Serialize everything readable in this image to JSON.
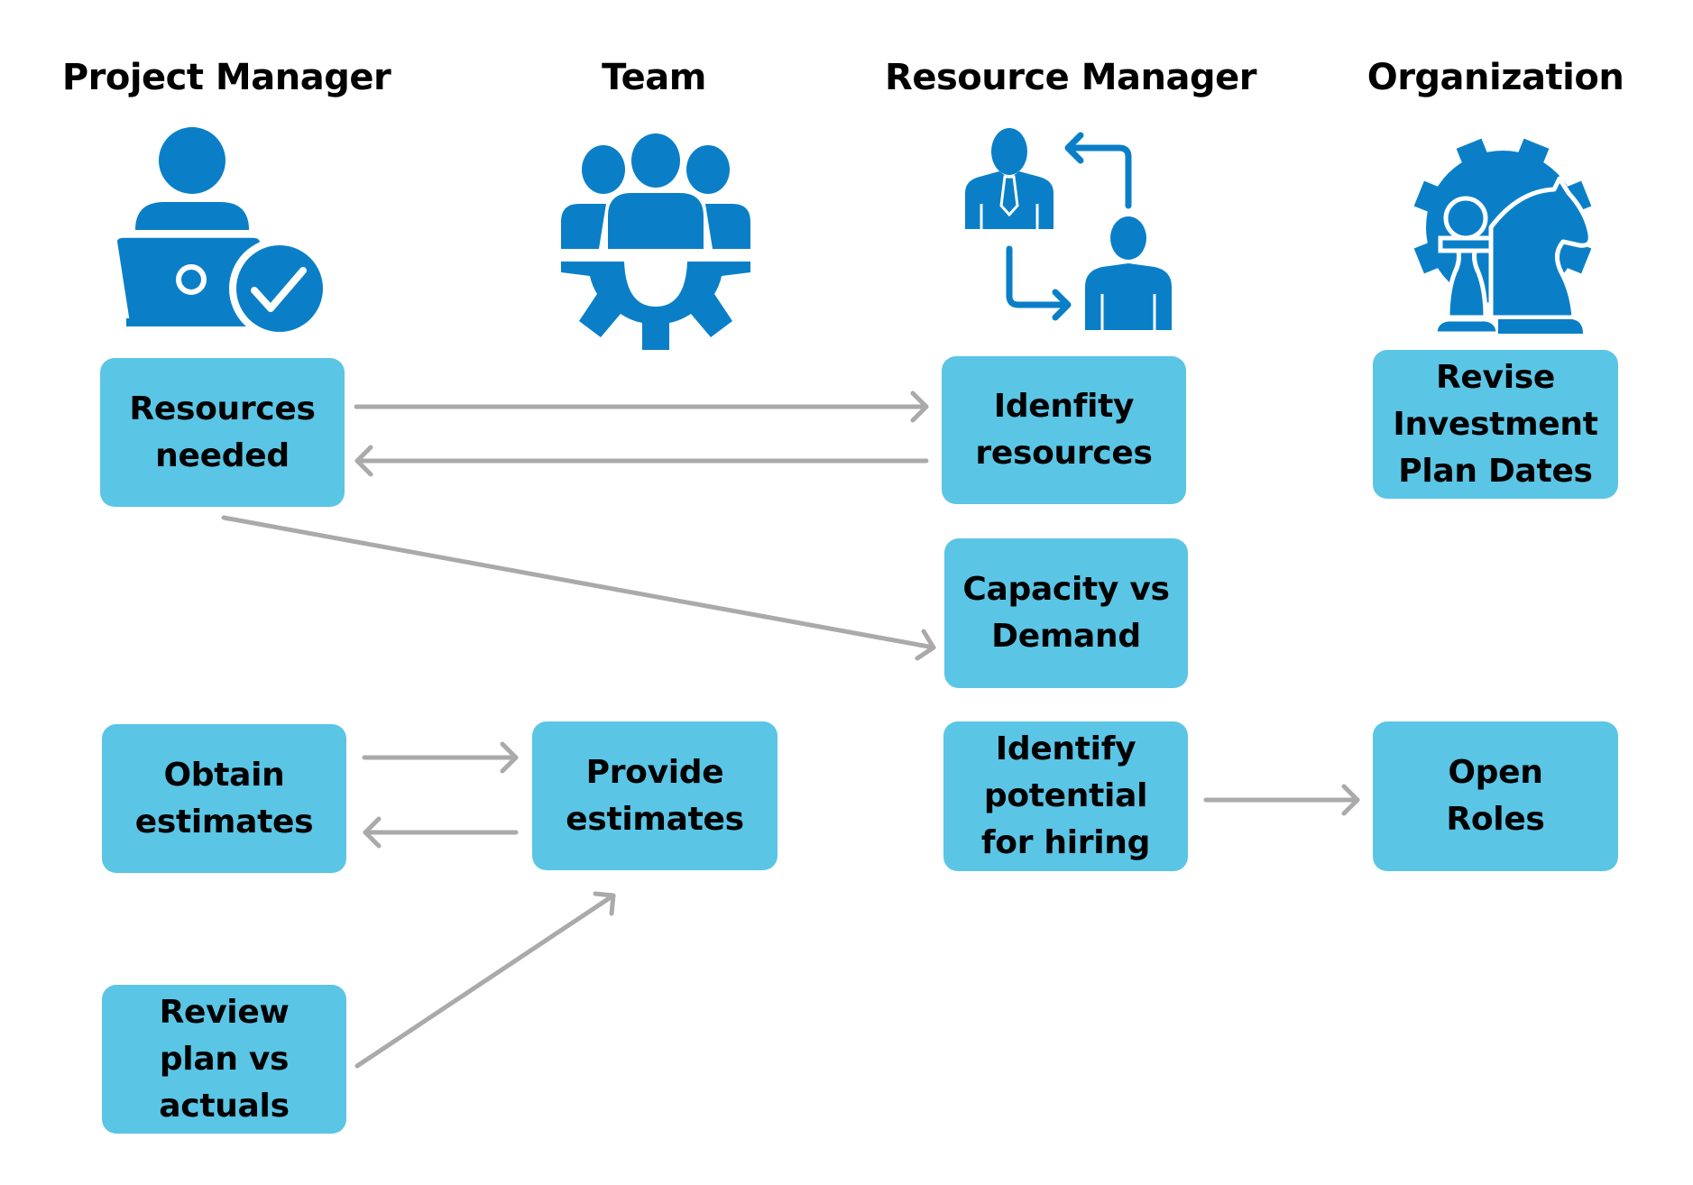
{
  "diagram": {
    "colors": {
      "box_fill": "#5BC5E5",
      "icon_blue": "#0A7FC8",
      "arrow_gray": "#AAAAAA",
      "text": "#000000"
    },
    "lanes": [
      {
        "id": "project-manager",
        "title": "Project Manager",
        "icon": "person-laptop-check-icon"
      },
      {
        "id": "team",
        "title": "Team",
        "icon": "team-gear-icon"
      },
      {
        "id": "resource-manager",
        "title": "Resource Manager",
        "icon": "people-exchange-icon"
      },
      {
        "id": "organization",
        "title": "Organization",
        "icon": "chess-gear-icon"
      }
    ],
    "nodes": {
      "resources_needed": {
        "lane": "project-manager",
        "lines": [
          "Resources",
          "needed"
        ]
      },
      "identify_resources": {
        "lane": "resource-manager",
        "lines": [
          "Idenfity",
          "resources"
        ]
      },
      "revise_dates": {
        "lane": "organization",
        "lines": [
          "Revise",
          "Investment",
          "Plan Dates"
        ]
      },
      "capacity_demand": {
        "lane": "resource-manager",
        "lines": [
          "Capacity vs",
          "Demand"
        ]
      },
      "obtain_estimates": {
        "lane": "project-manager",
        "lines": [
          "Obtain",
          "estimates"
        ]
      },
      "provide_estimates": {
        "lane": "team",
        "lines": [
          "Provide",
          "estimates"
        ]
      },
      "identify_hiring": {
        "lane": "resource-manager",
        "lines": [
          "Identify",
          "potential",
          "for hiring"
        ]
      },
      "open_roles": {
        "lane": "organization",
        "lines": [
          "Open",
          "Roles"
        ]
      },
      "review_plan": {
        "lane": "project-manager",
        "lines": [
          "Review",
          "plan vs",
          "actuals"
        ]
      }
    },
    "edges": [
      {
        "from": "resources_needed",
        "to": "identify_resources"
      },
      {
        "from": "identify_resources",
        "to": "resources_needed"
      },
      {
        "from": "resources_needed",
        "to": "capacity_demand"
      },
      {
        "from": "obtain_estimates",
        "to": "provide_estimates"
      },
      {
        "from": "provide_estimates",
        "to": "obtain_estimates"
      },
      {
        "from": "review_plan",
        "to": "provide_estimates"
      },
      {
        "from": "identify_hiring",
        "to": "open_roles"
      }
    ]
  }
}
